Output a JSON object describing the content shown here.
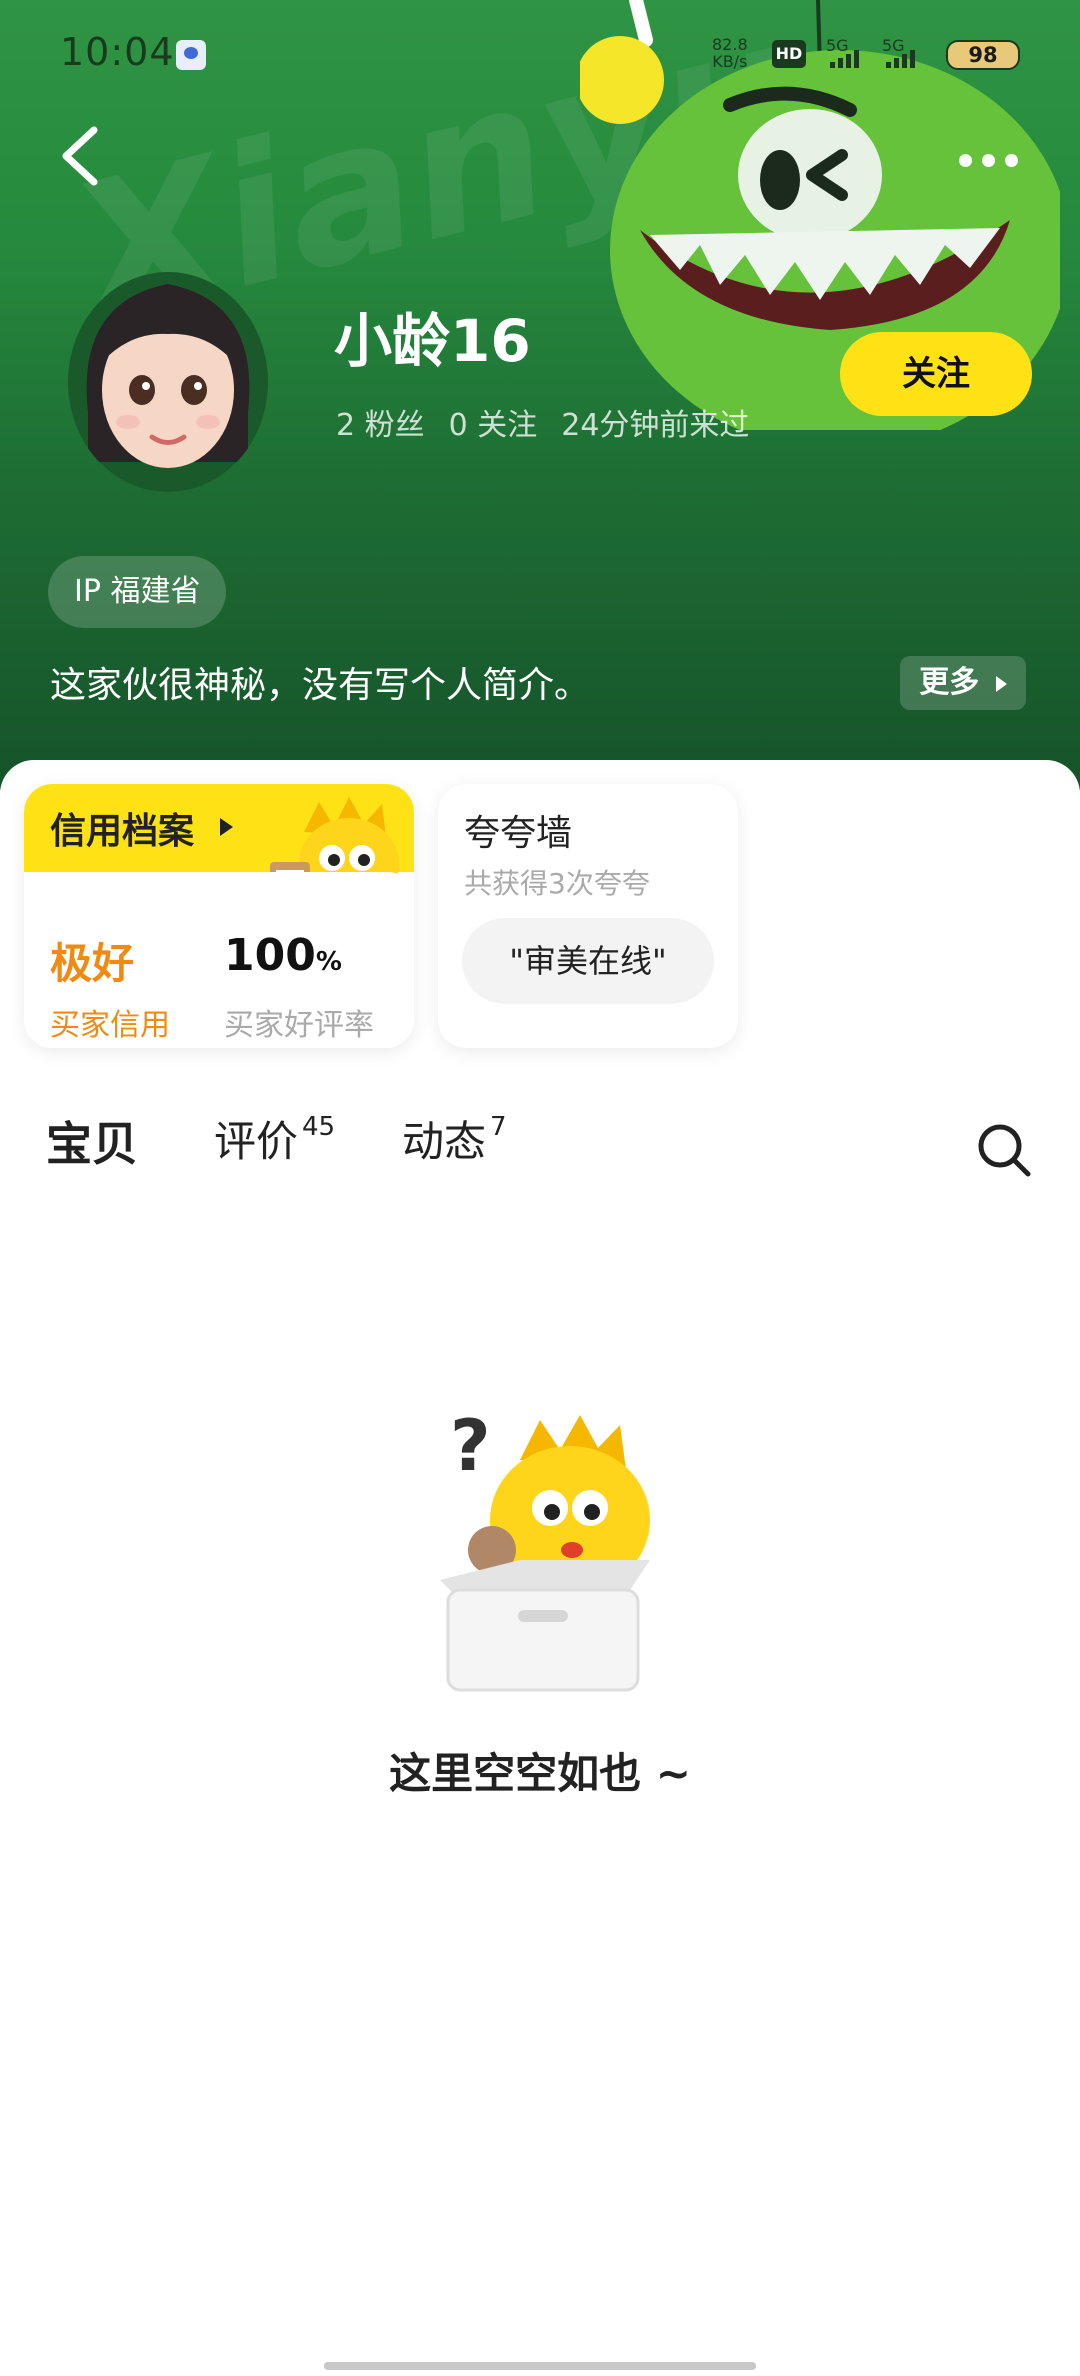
{
  "status_bar": {
    "time": "10:04",
    "net_speed_value": "82.8",
    "net_speed_unit": "KB/s",
    "hd_label": "HD",
    "signal1_label": "5G",
    "signal2_label": "5G",
    "battery": "98"
  },
  "header": {
    "watermark": "Xianyu",
    "username": "小龄16",
    "fans": "2 粉丝",
    "following": "0 关注",
    "last_seen": "24分钟前来过",
    "follow_label": "关注",
    "ip_label": "IP 福建省",
    "bio": "这家伙很神秘，没有写个人简介。",
    "more_label": "更多"
  },
  "credit_card": {
    "title": "信用档案",
    "rating_value": "极好",
    "rating_label": "买家信用",
    "rate_value": "100",
    "rate_unit": "%",
    "rate_label": "买家好评率"
  },
  "praise_card": {
    "title": "夸夸墙",
    "subtitle": "共获得3次夸夸",
    "chip": "\"审美在线\""
  },
  "tabs": [
    {
      "label": "宝贝",
      "count": ""
    },
    {
      "label": "评价",
      "count": "45"
    },
    {
      "label": "动态",
      "count": "7"
    }
  ],
  "empty_state": {
    "text": "这里空空如也 ~"
  },
  "colors": {
    "brand_yellow": "#ffe215",
    "header_green": "#268a3e",
    "credit_orange": "#f08a12"
  }
}
